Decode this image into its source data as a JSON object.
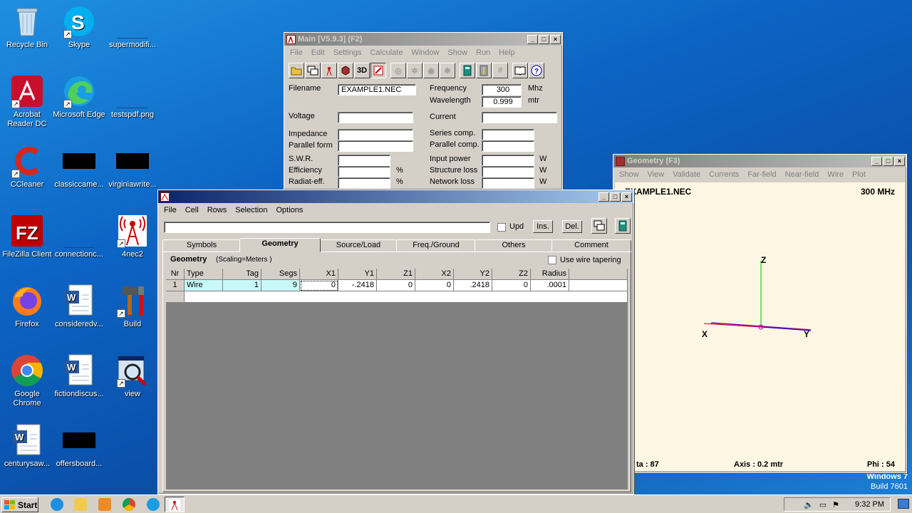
{
  "desktop_icons": [
    {
      "label": "Recycle Bin",
      "icon": "recycle-bin-icon"
    },
    {
      "label": "Skype",
      "icon": "skype-icon"
    },
    {
      "label": "supermodifi...",
      "icon": "file-icon"
    },
    {
      "label": "Acrobat Reader DC",
      "icon": "acrobat-icon"
    },
    {
      "label": "Microsoft Edge",
      "icon": "edge-icon"
    },
    {
      "label": "testspdf.png",
      "icon": "image-file-icon"
    },
    {
      "label": "CCleaner",
      "icon": "ccleaner-icon"
    },
    {
      "label": "classiccame...",
      "icon": "file-icon"
    },
    {
      "label": "virginiawrite...",
      "icon": "file-icon"
    },
    {
      "label": "FileZilla Client",
      "icon": "filezilla-icon"
    },
    {
      "label": "connectionc...",
      "icon": "file-icon"
    },
    {
      "label": "4nec2",
      "icon": "antenna-icon"
    },
    {
      "label": "Firefox",
      "icon": "firefox-icon"
    },
    {
      "label": "consideredv...",
      "icon": "word-doc-icon"
    },
    {
      "label": "Build",
      "icon": "build-tools-icon"
    },
    {
      "label": "Google Chrome",
      "icon": "chrome-icon"
    },
    {
      "label": "fictiondiscus...",
      "icon": "word-doc-icon"
    },
    {
      "label": "view",
      "icon": "view-magnifier-icon"
    },
    {
      "label": "centurysaw...",
      "icon": "word-doc-icon"
    },
    {
      "label": "offersboard...",
      "icon": "file-icon"
    }
  ],
  "main_window": {
    "title": "Main [V5.9.3]  (F2)",
    "menu": [
      "File",
      "Edit",
      "Settings",
      "Calculate",
      "Window",
      "Show",
      "Run",
      "Help"
    ],
    "toolbar_3d": "3D",
    "labels": {
      "filename": "Filename",
      "frequency": "Frequency",
      "wavelength": "Wavelength",
      "voltage": "Voltage",
      "current": "Current",
      "impedance": "Impedance",
      "series": "Series comp.",
      "parallel_form": "Parallel form",
      "parallel_comp": "Parallel comp.",
      "swr": "S.W.R.",
      "input_power": "Input power",
      "efficiency": "Efficiency",
      "structure_loss": "Structure loss",
      "radiat": "Radiat-eff.",
      "network_loss": "Network loss"
    },
    "values": {
      "filename": "EXAMPLE1.NEC",
      "frequency": "300",
      "wavelength": "0.999"
    },
    "units": {
      "mhz": "Mhz",
      "mtr": "mtr",
      "pct": "%",
      "w": "W"
    }
  },
  "geometry_editor": {
    "menu": [
      "File",
      "Cell",
      "Rows",
      "Selection",
      "Options"
    ],
    "upd_label": "Upd",
    "ins_label": "Ins.",
    "del_label": "Del.",
    "tabs": [
      "Symbols",
      "Geometry",
      "Source/Load",
      "Freq./Ground",
      "Others",
      "Comment"
    ],
    "section_title": "Geometry",
    "scaling": "(Scaling=Meters )",
    "tapering_label": "Use wire tapering",
    "columns": [
      "Nr",
      "Type",
      "Tag",
      "Segs",
      "X1",
      "Y1",
      "Z1",
      "X2",
      "Y2",
      "Z2",
      "Radius"
    ],
    "rows": [
      [
        "1",
        "Wire",
        "1",
        "9",
        "0",
        "-.2418",
        "0",
        "0",
        ".2418",
        "0",
        ".0001"
      ]
    ]
  },
  "geometry_window": {
    "title": "Geometry   (F3)",
    "menu": [
      "Show",
      "View",
      "Validate",
      "Currents",
      "Far-field",
      "Near-field",
      "Wire",
      "Plot"
    ],
    "filename": "EXAMPLE1.NEC",
    "frequency": "300 MHz",
    "theta": "ta : 87",
    "axis": "Axis : 0.2 mtr",
    "phi": "Phi : 54",
    "axis_x": "X",
    "axis_y": "Y",
    "axis_z": "Z"
  },
  "watermark": {
    "os": "Windows 7",
    "build": "Build 7601"
  },
  "taskbar": {
    "start": "Start",
    "time": "9:32 PM"
  }
}
